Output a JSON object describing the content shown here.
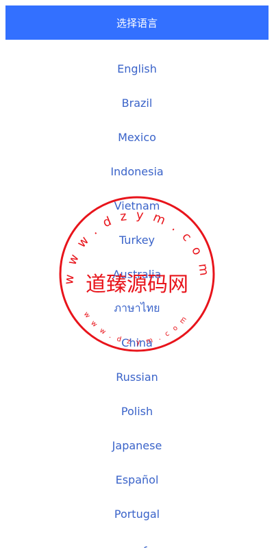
{
  "header": {
    "title": "选择语言"
  },
  "languages": [
    {
      "label": "English"
    },
    {
      "label": "Brazil"
    },
    {
      "label": "Mexico"
    },
    {
      "label": "Indonesia"
    },
    {
      "label": "Vietnam"
    },
    {
      "label": "Turkey"
    },
    {
      "label": "Australia"
    },
    {
      "label": "ภาษาไทย"
    },
    {
      "label": "China"
    },
    {
      "label": "Russian"
    },
    {
      "label": "Polish"
    },
    {
      "label": "Japanese"
    },
    {
      "label": "Español"
    },
    {
      "label": "Portugal"
    },
    {
      "label": "عربي"
    }
  ],
  "watermark": {
    "name": "道臻源码网",
    "outer_ring": "www.dzym.com",
    "inner_ring": "www.dzym.com"
  },
  "colors": {
    "header_bg": "#3370ff",
    "link": "#3a63c9",
    "stamp": "#e8141b"
  }
}
